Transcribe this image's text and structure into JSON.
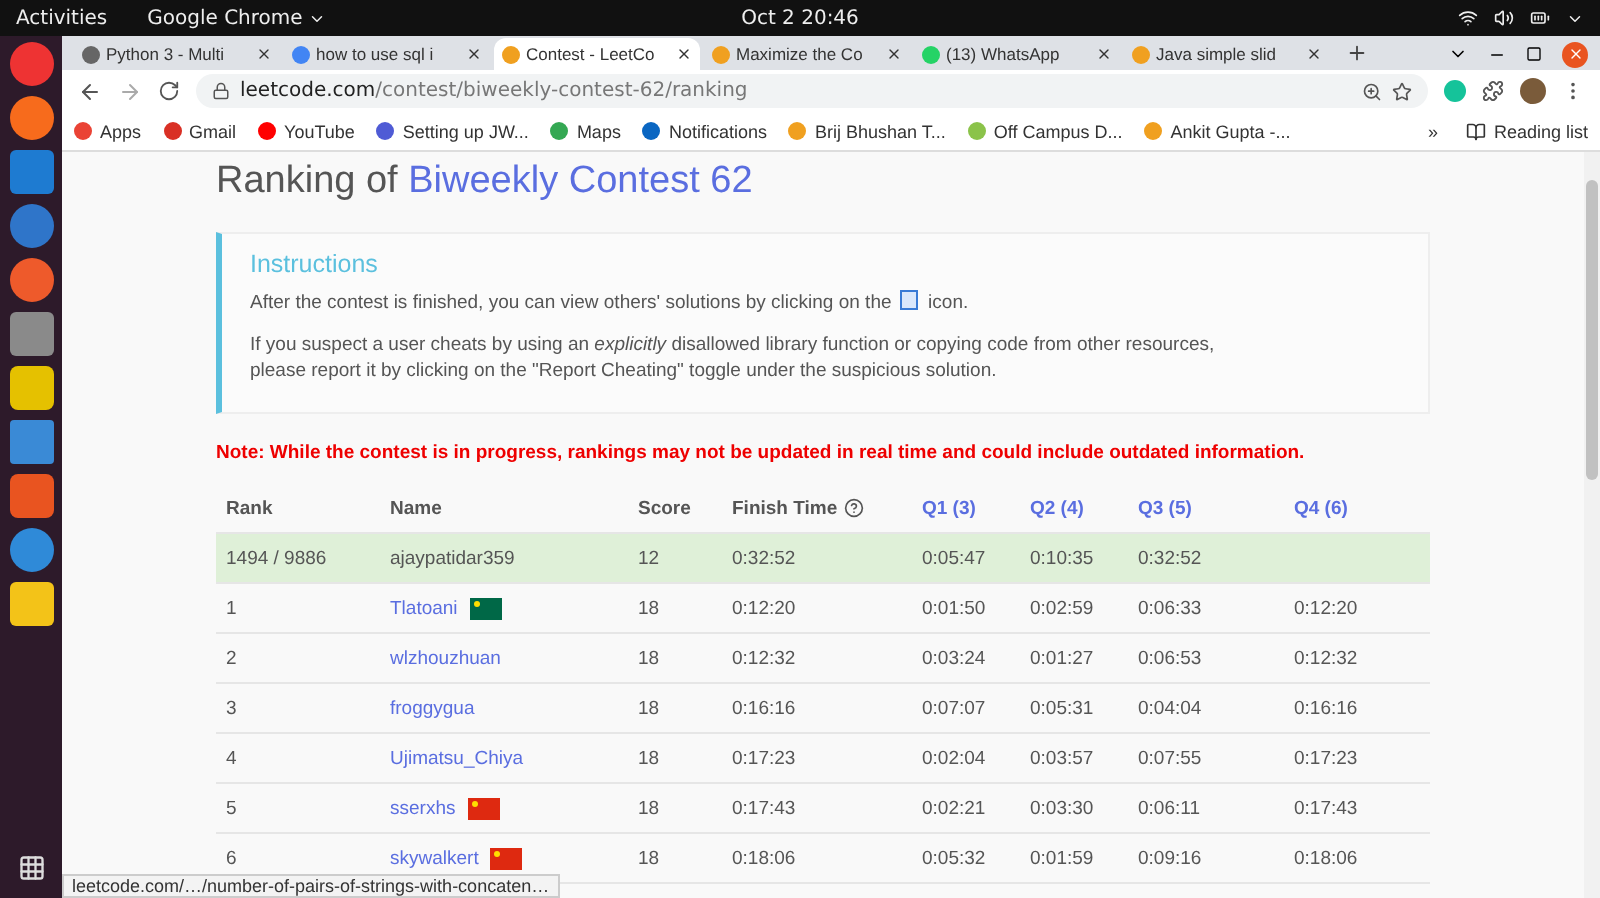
{
  "top_bar": {
    "activities": "Activities",
    "app": "Google Chrome",
    "clock": "Oct 2  20:46"
  },
  "tabs": [
    {
      "title": "Python 3 - Multi",
      "selected": false,
      "color": "#666666"
    },
    {
      "title": "how to use sql i",
      "selected": false,
      "color": "#4285f4"
    },
    {
      "title": "Contest - LeetCo",
      "selected": true,
      "color": "#f0a020"
    },
    {
      "title": "Maximize the Co",
      "selected": false,
      "color": "#f0a020"
    },
    {
      "title": "(13) WhatsApp",
      "selected": false,
      "color": "#25d366"
    },
    {
      "title": "Java simple slid",
      "selected": false,
      "color": "#f0a020"
    }
  ],
  "address": {
    "host": "leetcode.com",
    "path": "/contest/biweekly-contest-62/ranking"
  },
  "bookmarks": [
    {
      "label": "Apps",
      "color": "#ea4335"
    },
    {
      "label": "Gmail",
      "color": "#d93025"
    },
    {
      "label": "YouTube",
      "color": "#ff0000"
    },
    {
      "label": "Setting up JW...",
      "color": "#4f5bd5"
    },
    {
      "label": "Maps",
      "color": "#34a853"
    },
    {
      "label": "Notifications",
      "color": "#0a66c2"
    },
    {
      "label": "Brij Bhushan T...",
      "color": "#f0a020"
    },
    {
      "label": "Off Campus D...",
      "color": "#8bc34a"
    },
    {
      "label": "Ankit Gupta -...",
      "color": "#f0a020"
    }
  ],
  "more_bookmarks": "»",
  "reading_list": "Reading list",
  "page": {
    "title_prefix": "Ranking of ",
    "title_link": "Biweekly Contest 62",
    "instructions": {
      "heading": "Instructions",
      "line_1_before": "After the contest is finished, you can view others' solutions by clicking on the",
      "line_1_after": "icon.",
      "line_2": "If you suspect a user cheats by using an *explicitly* disallowed library function or copying code from other resources, please report it by clicking on the \"Report Cheating\" toggle under the suspicious solution."
    },
    "note": "Note: While the contest is in progress, rankings may not be updated in real time and could include outdated information.",
    "table": {
      "columns": [
        {
          "label": "Rank",
          "kind": "plain"
        },
        {
          "label": "Name",
          "kind": "plain"
        },
        {
          "label": "Score",
          "kind": "plain"
        },
        {
          "label": "Finish Time",
          "kind": "help"
        },
        {
          "label": "Q1 (3)",
          "kind": "link"
        },
        {
          "label": "Q2 (4)",
          "kind": "link"
        },
        {
          "label": "Q3 (5)",
          "kind": "link"
        },
        {
          "label": "Q4 (6)",
          "kind": "link"
        }
      ],
      "rows": [
        {
          "highlighted": true,
          "rank": "1494 / 9886",
          "name": "ajaypatidar359",
          "score": "12",
          "finish": "0:32:52",
          "q": [
            "0:05:47",
            "0:10:35",
            "0:32:52"
          ]
        },
        {
          "highlighted": false,
          "rank": "1",
          "name": "Tlatoani",
          "color": "#006847",
          "score": "18",
          "finish": "0:12:20",
          "q": [
            "0:01:50",
            "0:02:59",
            "0:06:33",
            "0:12:20"
          ]
        },
        {
          "highlighted": false,
          "rank": "2",
          "name": "wlzhouzhuan",
          "score": "18",
          "finish": "0:12:32",
          "q": [
            "0:03:24",
            "0:01:27",
            "0:06:53",
            "0:12:32"
          ]
        },
        {
          "highlighted": false,
          "rank": "3",
          "name": "froggygua",
          "score": "18",
          "finish": "0:16:16",
          "q": [
            "0:07:07",
            "0:05:31",
            "0:04:04",
            "0:16:16"
          ]
        },
        {
          "highlighted": false,
          "rank": "4",
          "name": "Ujimatsu_Chiya",
          "score": "18",
          "finish": "0:17:23",
          "q": [
            "0:02:04",
            "0:03:57",
            "0:07:55",
            "0:17:23"
          ]
        },
        {
          "highlighted": false,
          "rank": "5",
          "name": "sserxhs",
          "color": "#de2910",
          "score": "18",
          "finish": "0:17:43",
          "q": [
            "0:02:21",
            "0:03:30",
            "0:06:11",
            "0:17:43"
          ]
        },
        {
          "highlighted": false,
          "rank": "6",
          "name": "skywalkert",
          "color": "#de2910",
          "score": "18",
          "finish": "0:18:06",
          "q": [
            "0:05:32",
            "0:01:59",
            "0:09:16",
            "0:18:06"
          ]
        }
      ]
    }
  },
  "status_link": "leetcode.com/…/number-of-pairs-of-strings-with-concaten…"
}
